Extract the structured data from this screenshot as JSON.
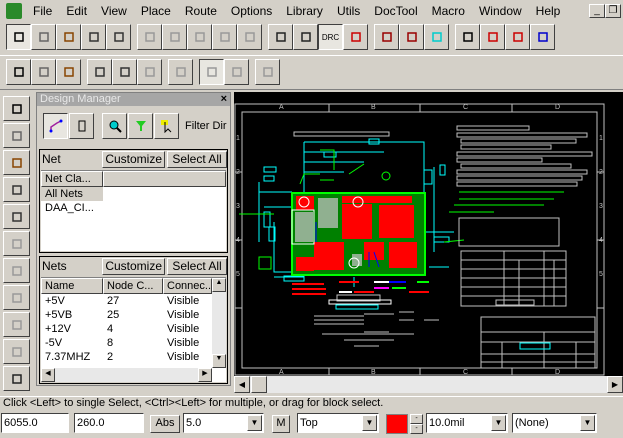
{
  "menu": [
    "File",
    "Edit",
    "View",
    "Place",
    "Route",
    "Options",
    "Library",
    "Utils",
    "DocTool",
    "Macro",
    "Window",
    "Help"
  ],
  "toolbar1": [
    "select-icon",
    "new-icon",
    "open-icon",
    "save-icon",
    "print-icon",
    "cut-icon",
    "copy-icon",
    "paste-icon",
    "undo-icon",
    "redo-icon",
    "measure-icon",
    "zoom-icon",
    "drc-icon",
    "eco-icon",
    "layer-pair-icon",
    "route-icon",
    "cam-icon",
    "spreadsheet-icon",
    "report-icon",
    "cluster-icon",
    "display-icon"
  ],
  "toolbar1_drc_label": "DRC",
  "toolbar2": [
    "add-route-icon",
    "dynamic-route-icon",
    "miter-icon",
    "bus-route-icon",
    "sketch-route-icon",
    "auto-route-icon",
    "fanout-icon",
    "tune-icon",
    "arc-icon",
    "pour-icon"
  ],
  "vtoolbar": [
    "component-icon",
    "route-icon",
    "pin-pad-icon",
    "via-icon",
    "line-icon",
    "arc-icon",
    "polygon-icon",
    "keepout-icon",
    "fill-icon",
    "layers-icon",
    "no-icon"
  ],
  "design_manager": {
    "title": "Design Manager",
    "filter_label": "Filter Dir",
    "net_section": {
      "label": "Net",
      "customize": "Customize",
      "select_all": "Select All",
      "column": "Net Cla...",
      "items": [
        "All Nets",
        "DAA_CI..."
      ]
    },
    "nets_section": {
      "label": "Nets",
      "customize": "Customize",
      "select_all": "Select All",
      "columns": [
        "Name",
        "Node C...",
        "Connec..."
      ],
      "rows": [
        [
          "+5V",
          "27",
          "Visible"
        ],
        [
          "+5VB",
          "25",
          "Visible"
        ],
        [
          "+12V",
          "4",
          "Visible"
        ],
        [
          "-5V",
          "8",
          "Visible"
        ],
        [
          "7.37MHZ",
          "2",
          "Visible"
        ]
      ]
    }
  },
  "canvas": {
    "zone_columns": [
      "A",
      "B",
      "C",
      "D"
    ],
    "zone_rows": [
      "1",
      "2",
      "3",
      "4",
      "5"
    ],
    "colors": {
      "background": "#000000",
      "board": "#00ff00",
      "copper": "#ff0000",
      "traces": "#00ffff",
      "text": "#c0c0c0"
    }
  },
  "status_text": "Click <Left> to single Select, <Ctrl><Left> for multiple, or drag for block select.",
  "bottombar": {
    "x": "6055.0",
    "y": "260.0",
    "abs": "Abs",
    "grid": "5.0",
    "m": "M",
    "layer": "Top",
    "layer_color": "#ff0000",
    "width": "10.0mil",
    "net": "(None)"
  }
}
